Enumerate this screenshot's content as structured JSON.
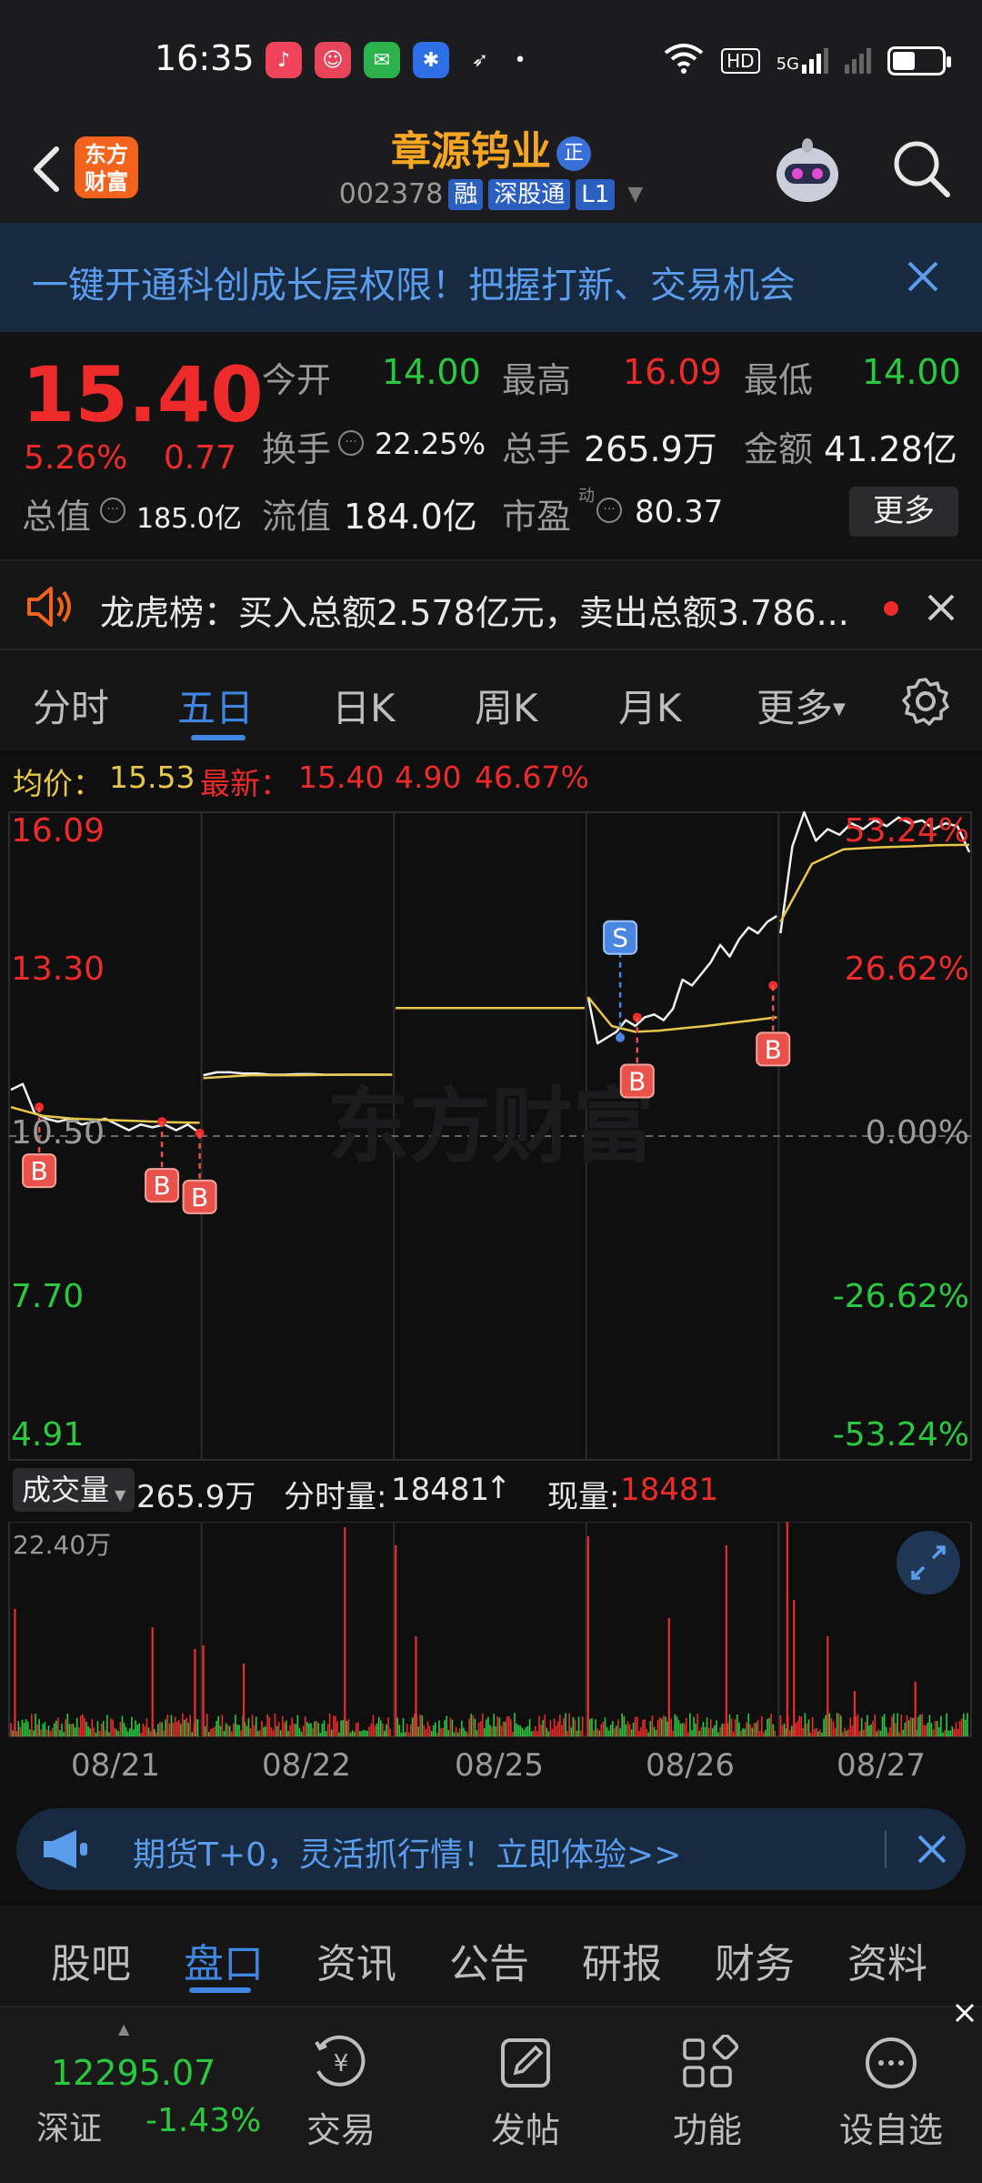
{
  "status": {
    "time": "16:35",
    "network": "HD",
    "signal": "5G"
  },
  "header": {
    "brand": "东方财富",
    "stock_name": "章源钨业",
    "stock_name_badge": "正",
    "stock_code": "002378",
    "tags": [
      "融",
      "深股通",
      "L1"
    ]
  },
  "promo": {
    "text": "一键开通科创成长层权限！把握打新、交易机会"
  },
  "quote": {
    "price": "15.40",
    "change_pct": "5.26%",
    "change": "0.77",
    "open_label": "今开",
    "open": "14.00",
    "high_label": "最高",
    "high": "16.09",
    "low_label": "最低",
    "low": "14.00",
    "turnover_label": "换手",
    "turnover": "22.25%",
    "volume_label": "总手",
    "volume": "265.9万",
    "amount_label": "金额",
    "amount": "41.28亿",
    "mktcap_label": "总值",
    "mktcap": "185.0亿",
    "float_label": "流值",
    "float": "184.0亿",
    "pe_label": "市盈",
    "pe_sup": "动",
    "pe": "80.37",
    "more": "更多"
  },
  "dragon": {
    "text": "龙虎榜：买入总额2.578亿元，卖出总额3.786..."
  },
  "tabs": [
    "分时",
    "五日",
    "日K",
    "周K",
    "月K",
    "更多"
  ],
  "avg": {
    "avg_label": "均价：",
    "avg_value": "15.53",
    "latest_label": "最新：",
    "latest_value": "15.40",
    "latest_change": "4.90",
    "latest_pct": "46.67%"
  },
  "chart_data": {
    "type": "line",
    "title": "",
    "y_price_labels": [
      "16.09",
      "13.30",
      "10.50",
      "7.70",
      "4.91"
    ],
    "y_pct_labels": [
      "53.24%",
      "26.62%",
      "0.00%",
      "-26.62%",
      "-53.24%"
    ],
    "ylim": [
      4.91,
      16.09
    ],
    "baseline": 10.5,
    "x_days": [
      "08/21",
      "08/22",
      "08/25",
      "08/26",
      "08/27"
    ],
    "price_series": [
      {
        "day": "08/21",
        "points": [
          11.3,
          11.4,
          10.9,
          10.8,
          10.75,
          10.8,
          10.7,
          10.75,
          10.8,
          10.7,
          10.6,
          10.7,
          10.65,
          10.7,
          10.6,
          10.7,
          10.55
        ]
      },
      {
        "day": "08/22",
        "points": [
          11.55,
          11.6,
          11.6,
          11.58,
          11.58,
          11.56,
          11.56,
          11.57,
          11.57,
          11.56,
          11.56,
          11.56,
          11.56,
          11.56,
          11.56
        ]
      },
      {
        "day": "08/25",
        "points": [
          12.71,
          12.71,
          12.71,
          12.71,
          12.71,
          12.71,
          12.71,
          12.71,
          12.71,
          12.71
        ]
      },
      {
        "day": "08/26",
        "points": [
          12.9,
          12.1,
          12.2,
          12.3,
          12.5,
          12.4,
          12.55,
          12.6,
          12.5,
          12.7,
          13.2,
          13.1,
          13.3,
          13.5,
          13.8,
          13.6,
          13.9,
          14.1,
          14.0,
          14.2,
          14.3
        ]
      },
      {
        "day": "08/27",
        "points": [
          14.0,
          15.5,
          16.09,
          15.6,
          15.8,
          15.7,
          15.9,
          15.8,
          15.95,
          15.85,
          16.0,
          15.9,
          15.95,
          15.8,
          15.9,
          15.85,
          15.4
        ]
      }
    ],
    "avg_series": [
      {
        "day": "08/21",
        "points": [
          11.0,
          10.85,
          10.8,
          10.78,
          10.76,
          10.74,
          10.73
        ]
      },
      {
        "day": "08/22",
        "points": [
          11.5,
          11.55,
          11.55,
          11.56,
          11.56
        ]
      },
      {
        "day": "08/25",
        "points": [
          12.71,
          12.71,
          12.71,
          12.71
        ]
      },
      {
        "day": "08/26",
        "points": [
          12.9,
          12.4,
          12.3,
          12.32,
          12.36,
          12.4,
          12.45,
          12.5,
          12.55
        ]
      },
      {
        "day": "08/27",
        "points": [
          14.2,
          15.2,
          15.45,
          15.48,
          15.5,
          15.52,
          15.53
        ]
      }
    ],
    "markers": [
      {
        "type": "B",
        "day": "08/21",
        "pos": 0.15,
        "price": 11.0
      },
      {
        "type": "B",
        "day": "08/21",
        "pos": 0.8,
        "price": 10.75
      },
      {
        "type": "B",
        "day": "08/21",
        "pos": 1.0,
        "price": 10.55
      },
      {
        "type": "S",
        "day": "08/26",
        "pos": 0.17,
        "price": 12.2
      },
      {
        "type": "B",
        "day": "08/26",
        "pos": 0.26,
        "price": 12.55
      },
      {
        "type": "B",
        "day": "08/26",
        "pos": 0.98,
        "price": 13.1
      }
    ],
    "grid": true
  },
  "volume": {
    "dropdown": "成交量",
    "total": "265.9万",
    "minute_label": "分时量:",
    "minute_value": "18481",
    "current_label": "现量:",
    "current_value": "18481",
    "scale_label": "22.40万"
  },
  "futures": {
    "text": "期货T+0，灵活抓行情！立即体验>>"
  },
  "bottom_tabs": [
    "股吧",
    "盘口",
    "资讯",
    "公告",
    "研报",
    "财务",
    "资料"
  ],
  "dock": {
    "index_value": "12295.07",
    "index_name": "深证",
    "index_pct": "-1.43%",
    "items": [
      "交易",
      "发帖",
      "功能",
      "设自选"
    ]
  },
  "colors": {
    "up": "#ee2b2b",
    "down": "#2ac93f",
    "accent": "#3f86e3",
    "brand": "#f2641e",
    "avg_line": "#e8c84a"
  }
}
